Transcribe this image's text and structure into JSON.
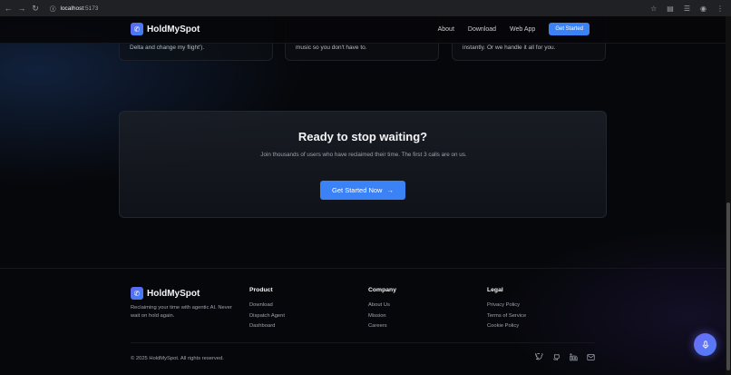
{
  "browser": {
    "url_host": "localhost",
    "url_port": ":5173"
  },
  "header": {
    "brand": "HoldMySpot",
    "nav": [
      "About",
      "Download",
      "Web App"
    ],
    "cta": "Get Started"
  },
  "features": [
    "Delta and change my flight').",
    "music so you don't have to.",
    "instantly. Or we handle it all for you."
  ],
  "cta_section": {
    "title": "Ready to stop waiting?",
    "subtitle": "Join thousands of users who have reclaimed their time. The first 3 calls are on us.",
    "button": "Get Started Now"
  },
  "footer": {
    "brand": "HoldMySpot",
    "tagline": "Reclaiming your time with agentic AI. Never wait on hold again.",
    "columns": [
      {
        "title": "Product",
        "links": [
          "Download",
          "Dispatch Agent",
          "Dashboard"
        ]
      },
      {
        "title": "Company",
        "links": [
          "About Us",
          "Mission",
          "Careers"
        ]
      },
      {
        "title": "Legal",
        "links": [
          "Privacy Policy",
          "Terms of Service",
          "Cookie Policy"
        ]
      }
    ],
    "copyright": "© 2025 HoldMySpot. All rights reserved.",
    "social": [
      "twitter-icon",
      "github-icon",
      "linkedin-icon",
      "mail-icon"
    ]
  },
  "colors": {
    "accent": "#3b82f6",
    "background": "#06070a"
  }
}
